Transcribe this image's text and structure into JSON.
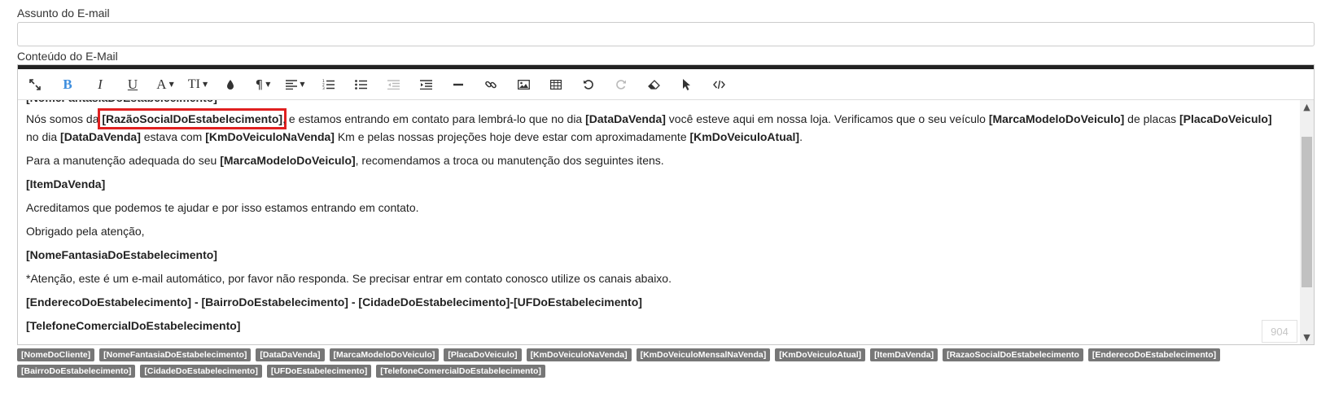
{
  "subject": {
    "label": "Assunto do E-mail",
    "value": "",
    "placeholder": ""
  },
  "content": {
    "label": "Conteúdo do E-Mail",
    "paragraphs": {
      "p1": {
        "t1": "Nós somos da ",
        "k1": "[RazãoSocialDoEstabelecimento]",
        "t2": ", e estamos entrando em contato para lembrá-lo que no dia ",
        "k2": "[DataDaVenda]",
        "t3": " você esteve aqui em nossa loja. Verificamos que o seu veículo ",
        "k3": "[MarcaModeloDoVeiculo]",
        "t4": " de placas ",
        "k4": "[PlacaDoVeiculo]",
        "t5": " no dia ",
        "k5": "[DataDaVenda]",
        "t6": " estava com ",
        "k6": "[KmDoVeiculoNaVenda]",
        "t7": " Km e pelas nossas projeções hoje deve estar com aproximadamente ",
        "k7": "[KmDoVeiculoAtual]",
        "t8": "."
      },
      "p2": {
        "t1": "Para a manutenção adequada do seu ",
        "k1": "[MarcaModeloDoVeiculo]",
        "t2": ", recomendamos a troca ou manutenção dos seguintes itens."
      },
      "p3": "[ItemDaVenda]",
      "p4": "Acreditamos que podemos te ajudar e por isso estamos entrando em contato.",
      "p5": "Obrigado pela atenção,",
      "p6": "[NomeFantasiaDoEstabelecimento]",
      "p7": "*Atenção, este é um e-mail automático, por favor não responda. Se precisar entrar em contato conosco utilize os canais abaixo.",
      "p8": "[EnderecoDoEstabelecimento] - [BairroDoEstabelecimento] - [CidadeDoEstabelecimento]-[UFDoEstabelecimento]",
      "p9": "[TelefoneComercialDoEstabelecimento]"
    },
    "word_count": "904"
  },
  "toolbar": {
    "font_color_glyph": "A",
    "font_size_glyph": "TI",
    "paragraph_glyph": "¶",
    "icons": [
      "fullscreen-icon",
      "bold-icon",
      "italic-icon",
      "underline-icon",
      "font-color-icon",
      "font-size-icon",
      "background-color-icon",
      "paragraph-style-icon",
      "align-icon",
      "ordered-list-icon",
      "unordered-list-icon",
      "outdent-icon",
      "indent-icon",
      "horizontal-rule-icon",
      "link-icon",
      "image-icon",
      "table-icon",
      "undo-icon",
      "redo-icon",
      "eraser-icon",
      "cursor-icon",
      "code-view-icon"
    ],
    "active_color": "#3e8ede"
  },
  "tags": [
    "[NomeDoCliente]",
    "[NomeFantasiaDoEstabelecimento]",
    "[DataDaVenda]",
    "[MarcaModeloDoVeiculo]",
    "[PlacaDoVeiculo]",
    "[KmDoVeiculoNaVenda]",
    "[KmDoVeiculoMensalNaVenda]",
    "[KmDoVeiculoAtual]",
    "[ItemDaVenda]",
    "[RazaoSocialDoEstabelecimento",
    "[EnderecoDoEstabelecimento]",
    "[BairroDoEstabelecimento]",
    "[CidadeDoEstabelecimento]",
    "[UFDoEstabelecimento]",
    "[TelefoneComercialDoEstabelecimento]"
  ],
  "colors": {
    "highlight_border": "#e02020",
    "tag_background": "#777777",
    "editor_topbar": "#222222"
  }
}
